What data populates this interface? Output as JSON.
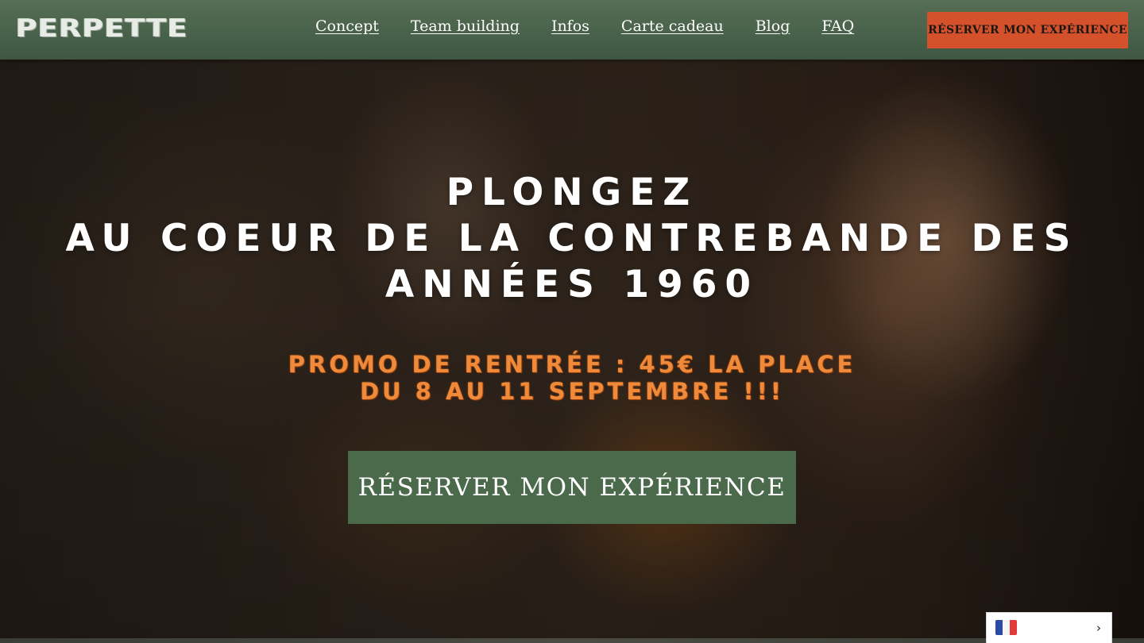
{
  "brand": {
    "logo_text": "PERPETTE"
  },
  "nav": {
    "links": [
      "Concept",
      "Team building",
      "Infos",
      "Carte cadeau",
      "Blog",
      "FAQ"
    ],
    "cta_label": "RÉSERVER MON EXPÉRIENCE"
  },
  "hero": {
    "headline_lines": [
      "PLONGEZ",
      "AU COEUR DE LA CONTREBANDE DES",
      "ANNÉES 1960"
    ],
    "promo_lines": [
      "PROMO DE RENTRÉE : 45€ LA PLACE",
      "DU 8 AU 11 SEPTEMBRE !!!"
    ],
    "cta_label": "RÉSERVER MON EXPÉRIENCE"
  },
  "language_selector": {
    "current": "fr",
    "flag_icon": "french-flag-icon",
    "chevron_icon": "chevron-right-icon"
  },
  "colors": {
    "navbar": "#4f684e",
    "nav_cta": "#d4512c",
    "hero_cta": "#4a6a4b",
    "promo_text": "#ee8a3a"
  }
}
